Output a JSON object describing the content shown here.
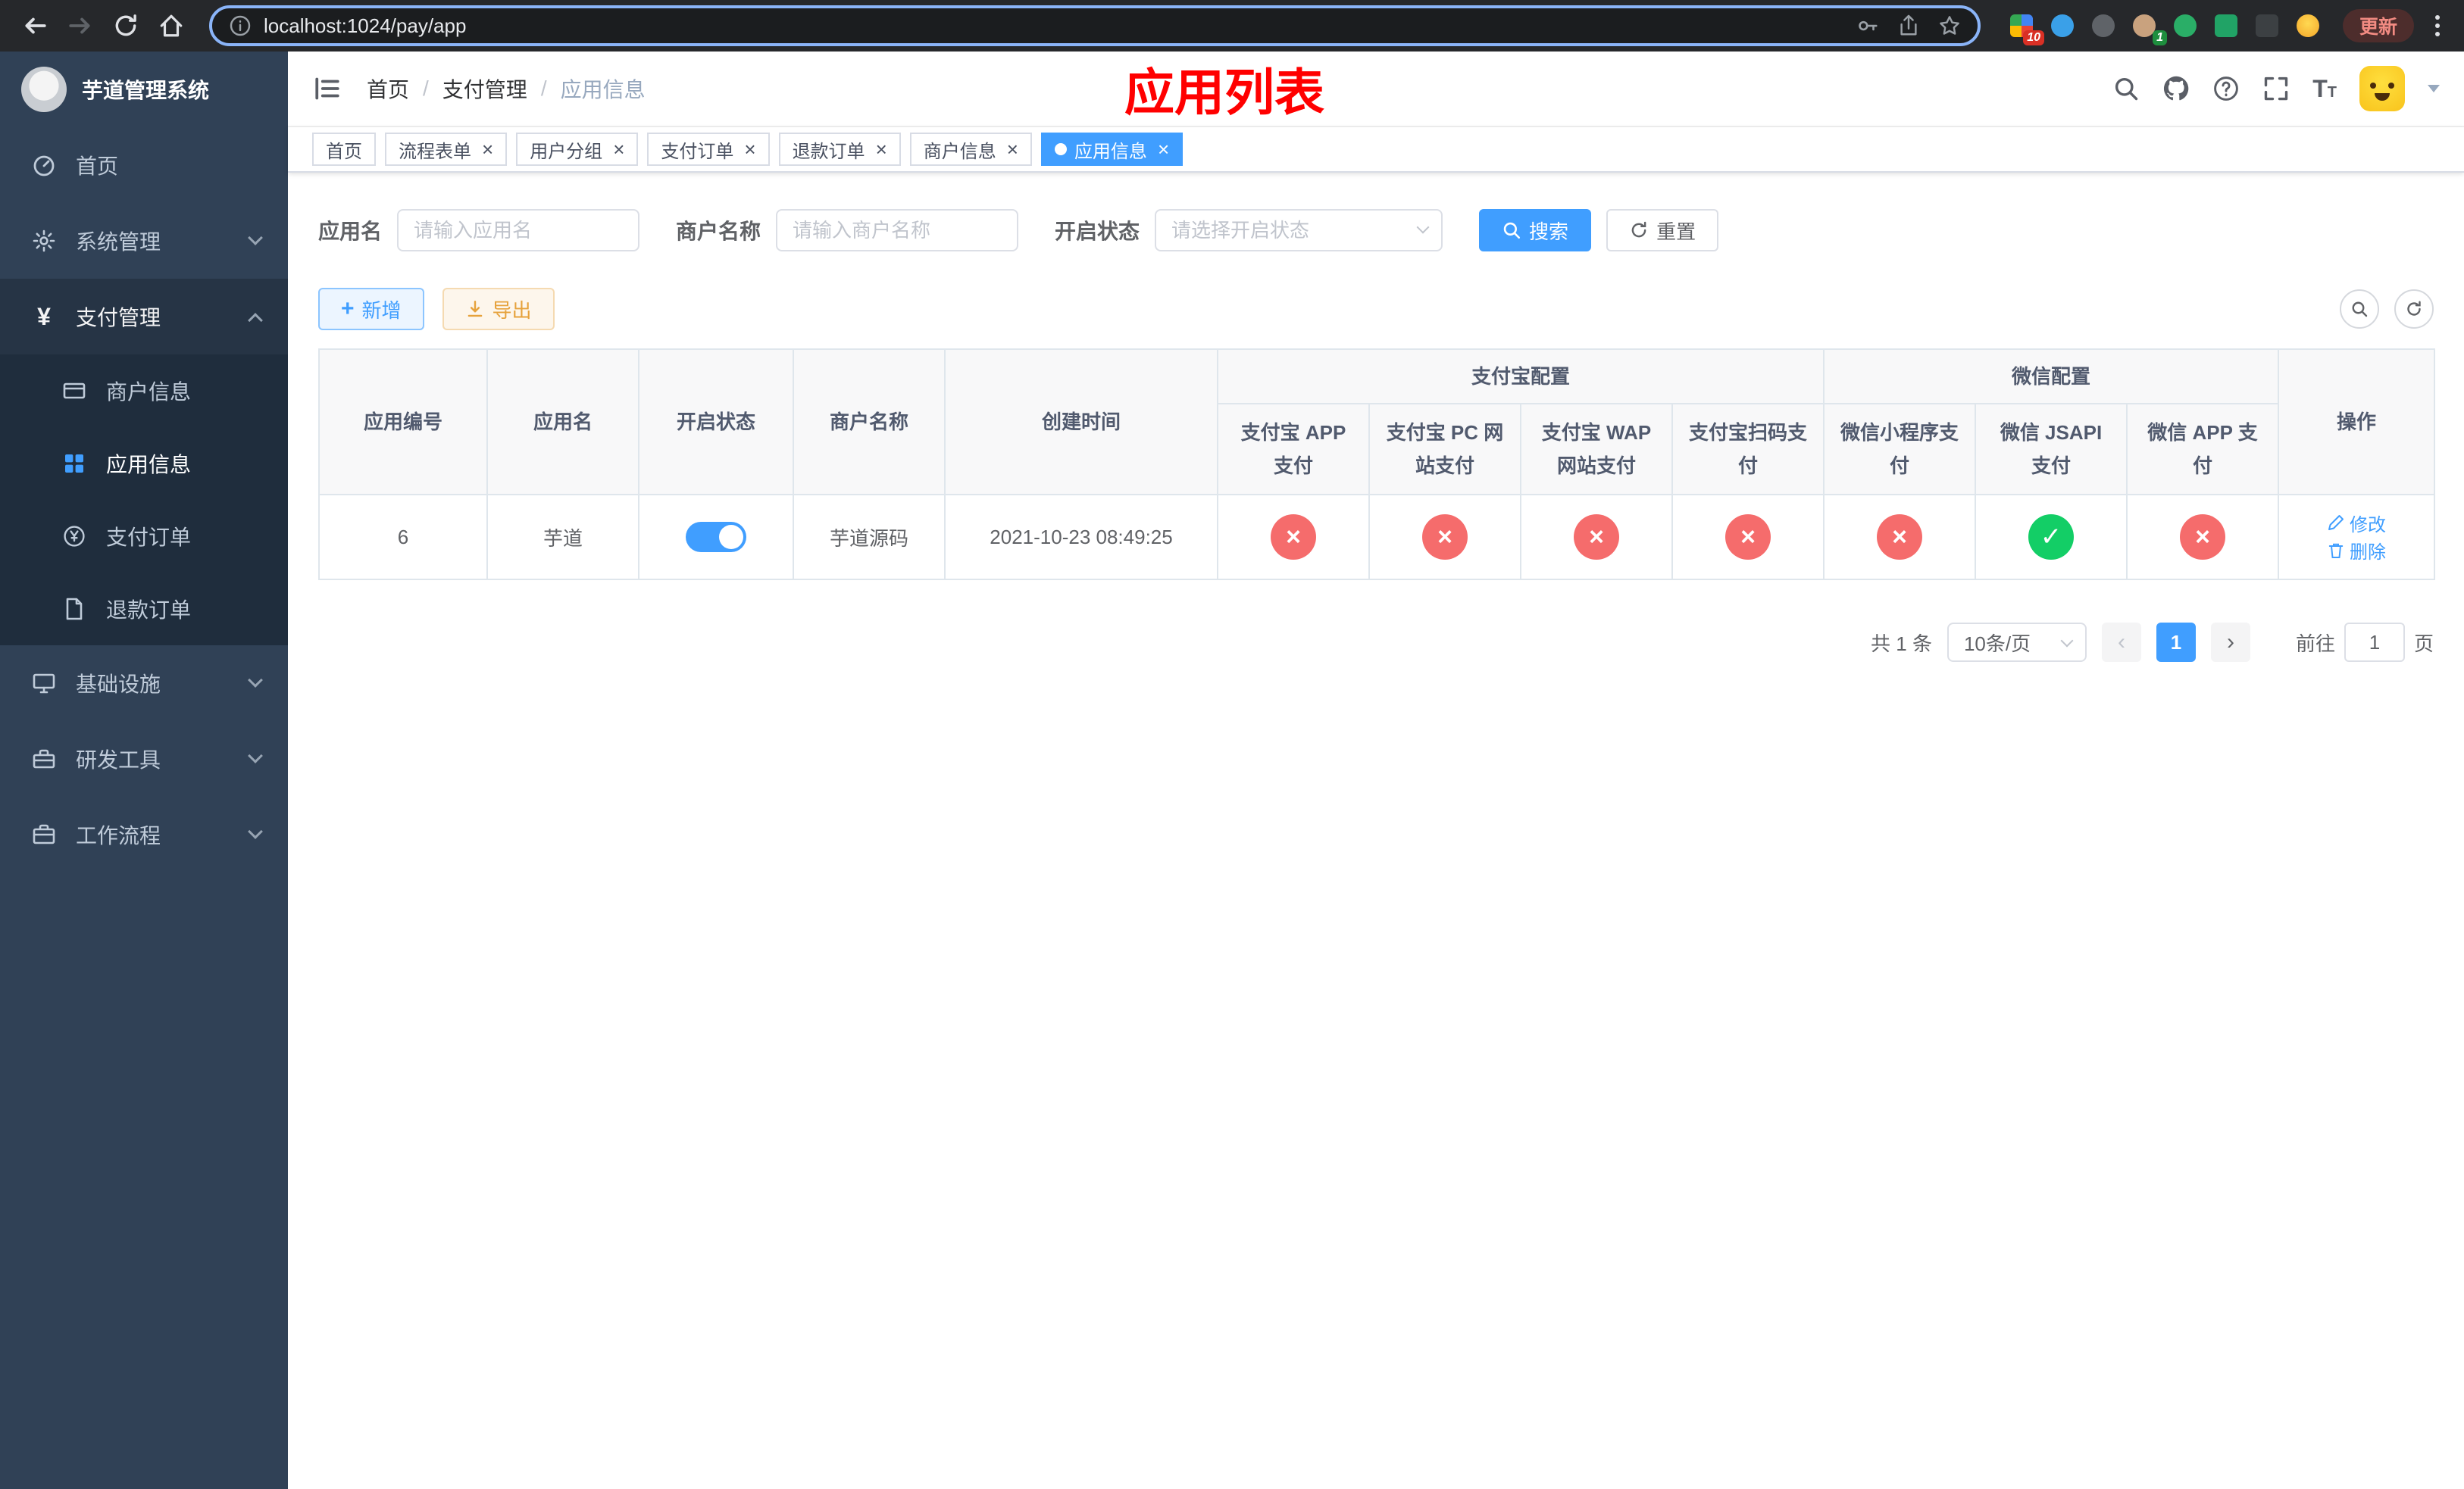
{
  "browser": {
    "url": "localhost:1024/pay/app",
    "update_label": "更新",
    "extension_badges": {
      "first": "10",
      "second": "1"
    }
  },
  "icons": {
    "close": "×",
    "check": "✓",
    "cross": "×",
    "plus": "+",
    "prev": "‹",
    "next": "›",
    "breadcrumb_separator": "/"
  },
  "sidebar": {
    "logo_title": "芋道管理系统",
    "items": [
      {
        "label": "首页"
      },
      {
        "label": "系统管理"
      },
      {
        "label": "支付管理",
        "expanded": true,
        "children": [
          {
            "label": "商户信息"
          },
          {
            "label": "应用信息",
            "active": true
          },
          {
            "label": "支付订单"
          },
          {
            "label": "退款订单"
          }
        ]
      },
      {
        "label": "基础设施"
      },
      {
        "label": "研发工具"
      },
      {
        "label": "工作流程"
      }
    ]
  },
  "header": {
    "breadcrumb": [
      "首页",
      "支付管理",
      "应用信息"
    ],
    "page_title": "应用列表"
  },
  "tabs": [
    {
      "label": "首页",
      "closable": false
    },
    {
      "label": "流程表单",
      "closable": true
    },
    {
      "label": "用户分组",
      "closable": true
    },
    {
      "label": "支付订单",
      "closable": true
    },
    {
      "label": "退款订单",
      "closable": true
    },
    {
      "label": "商户信息",
      "closable": true
    },
    {
      "label": "应用信息",
      "closable": true,
      "active": true
    }
  ],
  "filters": {
    "app_name_label": "应用名",
    "app_name_placeholder": "请输入应用名",
    "merchant_label": "商户名称",
    "merchant_placeholder": "请输入商户名称",
    "status_label": "开启状态",
    "status_placeholder": "请选择开启状态",
    "search_label": "搜索",
    "reset_label": "重置"
  },
  "toolbar": {
    "add_label": "新增",
    "export_label": "导出"
  },
  "table": {
    "group_headers": {
      "alipay": "支付宝配置",
      "wechat": "微信配置"
    },
    "columns": [
      "应用编号",
      "应用名",
      "开启状态",
      "商户名称",
      "创建时间",
      "支付宝 APP 支付",
      "支付宝 PC 网站支付",
      "支付宝 WAP 网站支付",
      "支付宝扫码支付",
      "微信小程序支付",
      "微信 JSAPI 支付",
      "微信 APP 支付",
      "操作"
    ],
    "rows": [
      {
        "id": "6",
        "name": "芋道",
        "enabled": true,
        "merchant": "芋道源码",
        "created_at": "2021-10-23 08:49:25",
        "alipay_app": false,
        "alipay_pc": false,
        "alipay_wap": false,
        "alipay_qr": false,
        "wx_mini": false,
        "wx_jsapi": true,
        "wx_app": false,
        "actions": [
          "修改",
          "删除"
        ]
      }
    ]
  },
  "pagination": {
    "total_label": "共 1 条",
    "page_size": "10条/页",
    "current_page": "1",
    "goto_label": "前往",
    "goto_value": "1",
    "page_label": "页"
  }
}
